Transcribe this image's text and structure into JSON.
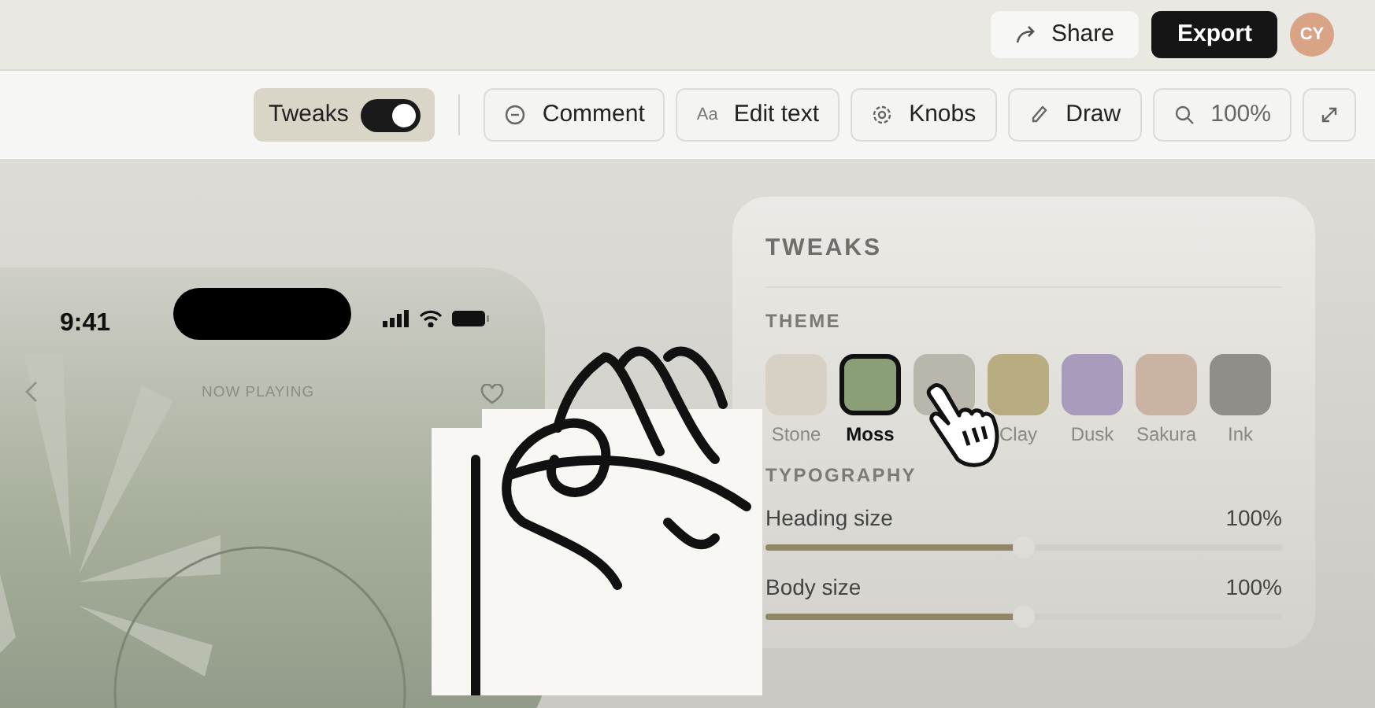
{
  "topbar": {
    "share": "Share",
    "export": "Export",
    "avatar": "CY"
  },
  "toolbar": {
    "tweaks": {
      "label": "Tweaks",
      "on": true,
      "selected": true
    },
    "tools": [
      {
        "kind": "comment",
        "label": "Comment"
      },
      {
        "kind": "text",
        "glyph": "Aa",
        "label": "Edit text"
      },
      {
        "kind": "knobs",
        "label": "Knobs"
      },
      {
        "kind": "draw",
        "label": "Draw"
      },
      {
        "kind": "zoom",
        "label": "100%"
      }
    ]
  },
  "phone": {
    "time": "9:41",
    "title": "NOW PLAYING"
  },
  "tweaks_panel": {
    "title": "TWEAKS",
    "theme_heading": "THEME",
    "themes": [
      {
        "label": "Stone",
        "color": "#d6d1c4",
        "selected": false
      },
      {
        "label": "Moss",
        "color": "#8a9f78",
        "selected": true
      },
      {
        "color": "#b9b7ab",
        "selected": false
      },
      {
        "label": "Clay",
        "color": "#b8ad80",
        "selected": false
      },
      {
        "label": "Dusk",
        "color": "#a89bbb",
        "selected": false
      },
      {
        "label": "Sakura",
        "color": "#c9b3a3",
        "selected": false
      },
      {
        "label": "Ink",
        "color": "#8f8e89",
        "selected": false
      }
    ],
    "typography_heading": "TYPOGRAPHY",
    "sliders": [
      {
        "label": "Heading size",
        "reading": "100%",
        "level": 0.5
      },
      {
        "label": "Body size",
        "reading": "100%",
        "level": 0.5
      }
    ]
  }
}
